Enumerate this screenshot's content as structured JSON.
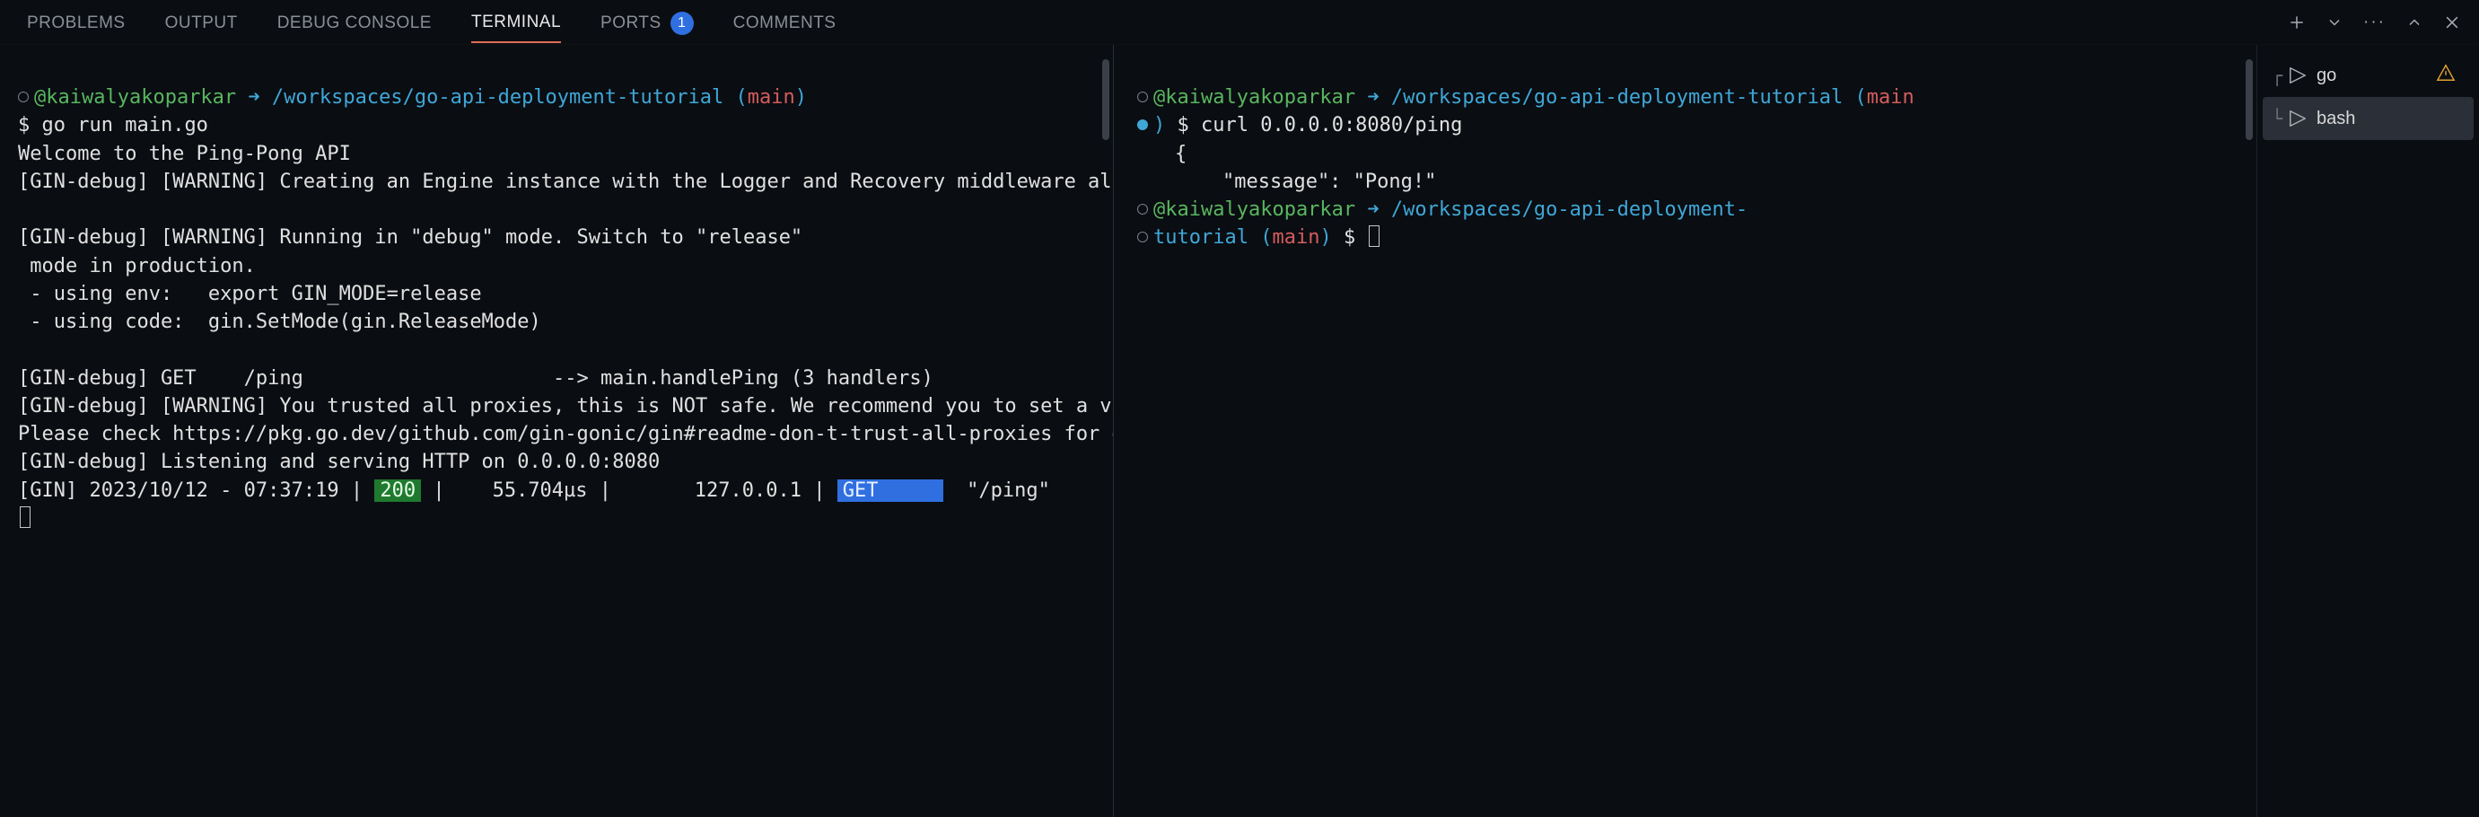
{
  "tabs": {
    "problems": "PROBLEMS",
    "output": "OUTPUT",
    "debug_console": "DEBUG CONSOLE",
    "terminal": "TERMINAL",
    "ports": "PORTS",
    "ports_badge": "1",
    "comments": "COMMENTS"
  },
  "prompt": {
    "user": "@kaiwalyakoparkar",
    "path": "/workspaces/go-api-deployment-tutorial",
    "branch": "main",
    "paren_open": "(",
    "paren_close": ")",
    "dollar": "$"
  },
  "left": {
    "cmd": "go run main.go",
    "welcome": "Welcome to the Ping-Pong API",
    "gin_instance": "[GIN-debug] [WARNING] Creating an Engine instance with the Logger and Recovery middleware already attached.",
    "gin_debug_mode_l1": "[GIN-debug] [WARNING] Running in \"debug\" mode. Switch to \"release\"",
    "gin_debug_mode_l2": " mode in production.",
    "gin_env": " - using env:   export GIN_MODE=release",
    "gin_code": " - using code:  gin.SetMode(gin.ReleaseMode)",
    "route": "[GIN-debug] GET    /ping                     --> main.handlePing (3 handlers)",
    "proxy_l1": "[GIN-debug] [WARNING] You trusted all proxies, this is NOT safe. We recommend you to set a value.",
    "proxy_l2": "Please check https://pkg.go.dev/github.com/gin-gonic/gin#readme-don-t-trust-all-proxies for details.",
    "listen": "[GIN-debug] Listening and serving HTTP on 0.0.0.0:8080",
    "req_prefix": "[GIN] 2023/10/12 - 07:37:19 | ",
    "req_status": "200",
    "req_mid": " |    55.704µs |       127.0.0.1 | ",
    "req_method": "GET     ",
    "req_path": "  \"/ping\""
  },
  "right": {
    "cmd": "curl 0.0.0.0:8080/ping",
    "body_open": "{",
    "body_msg": "    \"message\": \"Pong!\"",
    "path_wrap": "/workspaces/go-api-deployment-"
  },
  "sidelist": {
    "go": "go",
    "bash": "bash"
  }
}
